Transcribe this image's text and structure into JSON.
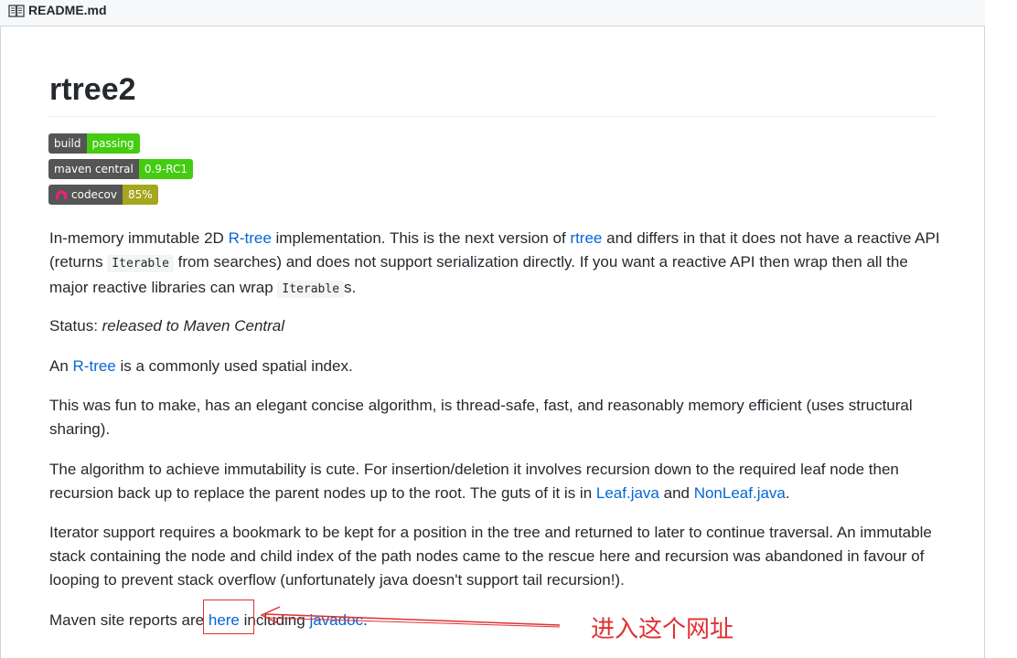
{
  "file_header": {
    "icon": "book-icon",
    "filename": "README.md"
  },
  "title": "rtree2",
  "badges": [
    {
      "label": "build",
      "value": "passing",
      "color": "#4c1"
    },
    {
      "label": "maven central",
      "value": "0.9-RC1",
      "color": "#4c1"
    },
    {
      "label": "codecov",
      "value": "85%",
      "color": "#a4a61d",
      "icon": "codecov-icon"
    }
  ],
  "p1": {
    "a": "In-memory immutable 2D ",
    "link1": "R-tree",
    "b": " implementation. This is the next version of ",
    "link2": "rtree",
    "c": " and differs in that it does not have a reactive API (returns ",
    "code1": "Iterable",
    "d": " from searches) and does not support serialization directly. If you want a reactive API then wrap then all the major reactive libraries can wrap ",
    "code2": "Iterable",
    "e": "s."
  },
  "status": {
    "label": "Status: ",
    "value": "released to Maven Central"
  },
  "p3": {
    "a": "An ",
    "link": "R-tree",
    "b": " is a commonly used spatial index."
  },
  "p4": "This was fun to make, has an elegant concise algorithm, is thread-safe, fast, and reasonably memory efficient (uses structural sharing).",
  "p5": {
    "a": "The algorithm to achieve immutability is cute. For insertion/deletion it involves recursion down to the required leaf node then recursion back up to replace the parent nodes up to the root. The guts of it is in ",
    "link1": "Leaf.java",
    "b": " and ",
    "link2": "NonLeaf.java",
    "c": "."
  },
  "p6": "Iterator support requires a bookmark to be kept for a position in the tree and returned to later to continue traversal. An immutable stack containing the node and child index of the path nodes came to the rescue here and recursion was abandoned in favour of looping to prevent stack overflow (unfortunately java doesn't support tail recursion!).",
  "p7": {
    "a": "Maven site reports are ",
    "link1": "here",
    "b": " including ",
    "link2": "javadoc",
    "c": "."
  },
  "annotation": {
    "text": "进入这个网址",
    "color": "#e03131"
  }
}
